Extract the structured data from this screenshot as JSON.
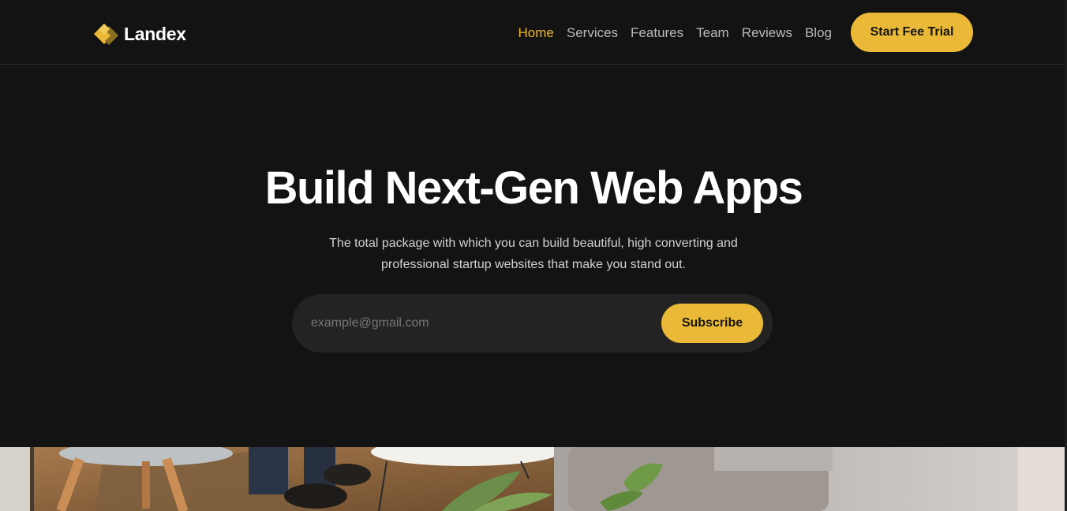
{
  "brand": {
    "name": "Landex",
    "logo_icon": "diamond-logo-icon",
    "accent_color": "#e9b937"
  },
  "nav": {
    "items": [
      {
        "label": "Home",
        "active": true
      },
      {
        "label": "Services",
        "active": false
      },
      {
        "label": "Features",
        "active": false
      },
      {
        "label": "Team",
        "active": false
      },
      {
        "label": "Reviews",
        "active": false
      },
      {
        "label": "Blog",
        "active": false
      }
    ],
    "cta_label": "Start Fee Trial"
  },
  "hero": {
    "title": "Build Next-Gen Web Apps",
    "subtitle_line1": "The total package with which you can build beautiful, high converting and",
    "subtitle_line2": "professional startup websites that make you stand out.",
    "email_placeholder": "example@gmail.com",
    "subscribe_label": "Subscribe"
  },
  "colors": {
    "background": "#131313",
    "input_background": "#232323",
    "nav_text": "#b9b9b9"
  }
}
